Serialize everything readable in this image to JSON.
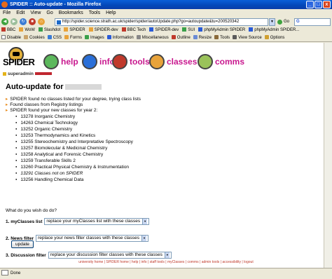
{
  "window": {
    "title": "SPIDER :: Auto-update - Mozilla Firefox",
    "min": "_",
    "max": "□",
    "close": "x"
  },
  "menu": [
    "File",
    "Edit",
    "View",
    "Go",
    "Bookmarks",
    "Tools",
    "Help"
  ],
  "address": {
    "url": "http://spider.science.strath.ac.uk/spider/spider/autoUpdate.php?go=autoupdate&tu=200520342",
    "go_label": "Go",
    "search_label": "G"
  },
  "bookmarks": [
    "BBC",
    "WoW",
    "Slashdot",
    "SPIDER",
    "SPIDER-dev",
    "BBC Tech",
    "SPIDER-dev",
    "SUI",
    "phpMyAdmin SPIDER",
    "phpMyAdmin SPIDER..."
  ],
  "webdev_toolbar": [
    "Disable",
    "Cookies",
    "CSS",
    "Forms",
    "Images",
    "Information",
    "Miscellaneous",
    "Outline",
    "Resize",
    "Tools",
    "View Source",
    "Options"
  ],
  "site": {
    "logo": "SPIDER",
    "nav": [
      "help",
      "info",
      "tools",
      "classes",
      "comms"
    ],
    "user": "superadmin"
  },
  "page": {
    "title": "Auto-update for",
    "messages": [
      "SPIDER found no classes listed for your degree, trying class lists",
      "Found classes from Registry listings",
      "SPIDER found your new classes for year 2:"
    ],
    "classes": [
      "13278 Inorganic Chemistry",
      "14263 Chemical Technology",
      "13252 Organic Chemistry",
      "13253 Thermodynamics and Kinetics",
      "13255 Stereochemistry and Interpretative Spectroscopy",
      "13257 Biomolecular & Medicinal Chemistry",
      "13258 Analytical and Forensic Chemistry",
      "13259 Transferable Skills 2",
      "13260 Practical Physical Chemistry & Instrumentation",
      "13291 Classes not on SPIDER",
      "13256 Handling Chemical Data"
    ],
    "question": "What do you wish do do?",
    "filters": [
      {
        "label": "1. myClasses list",
        "value": "replace your myClasses list with these classes"
      },
      {
        "label": "2. News filter",
        "value": "replace your news filter classes with these classes"
      },
      {
        "label": "3. Discussion filter",
        "value": "replace your discussion filter classes with these classes"
      }
    ],
    "update_label": "update",
    "footer": "university home | SPIDER home | help | info | staff tools | myClasses | comms | admin tools | accessibility | logout"
  },
  "status": "Done"
}
